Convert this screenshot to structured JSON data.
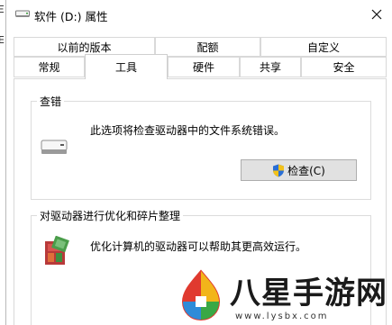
{
  "background_fragments": [
    "Ξ",
    "E"
  ],
  "window": {
    "title": "软件 (D:) 属性",
    "close_glyph": "✕"
  },
  "tabs": {
    "row1": [
      "以前的版本",
      "配额",
      "自定义"
    ],
    "row2": [
      "常规",
      "工具",
      "硬件",
      "共享",
      "安全"
    ],
    "active": "工具"
  },
  "error_checking": {
    "heading": "查错",
    "description": "此选项将检查驱动器中的文件系统错误。",
    "button_label": "检查(C)"
  },
  "optimize": {
    "heading": "对驱动器进行优化和碎片整理",
    "description": "优化计算机的驱动器可以帮助其更高效运行。"
  },
  "watermark": {
    "text": "八星手游网",
    "url": "www.lysbx.com"
  },
  "colors": {
    "button_face": "#e1e1e1",
    "border": "#d9d9d9",
    "shield_blue": "#2a6fd6",
    "shield_yellow": "#f2c21b"
  }
}
